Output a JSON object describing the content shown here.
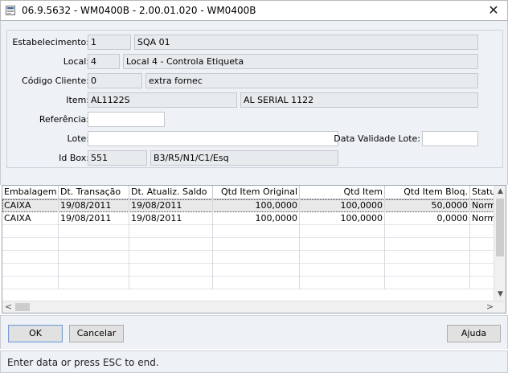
{
  "window": {
    "title": "06.9.5632 - WM0400B - 2.00.01.020 - WM0400B",
    "close_glyph": "✕"
  },
  "form": {
    "estabelecimento": {
      "label": "Estabelecimento:",
      "code": "1",
      "desc": "SQA 01"
    },
    "local": {
      "label": "Local:",
      "code": "4",
      "desc": "Local 4 - Controla Etiqueta"
    },
    "codigo_cliente": {
      "label": "Código Cliente:",
      "code": "0",
      "desc": "extra fornec"
    },
    "item": {
      "label": "Item:",
      "code": "AL1122S",
      "desc": "AL SERIAL 1122"
    },
    "referencia": {
      "label": "Referência:",
      "value": ""
    },
    "lote": {
      "label": "Lote:",
      "value": ""
    },
    "data_validade_lote": {
      "label": "Data Validade Lote:",
      "value": ""
    },
    "id_box": {
      "label": "Id Box:",
      "code": "551",
      "desc": "B3/R5/N1/C1/Esq"
    }
  },
  "grid": {
    "columns": [
      "Embalagem",
      "Dt. Transação",
      "Dt. Atualiz. Saldo",
      "Qtd Item Original",
      "Qtd Item",
      "Qtd Item Bloq.",
      "Status"
    ],
    "rows": [
      {
        "embalagem": "CAIXA",
        "dt_transacao": "19/08/2011",
        "dt_atualiz": "19/08/2011",
        "qtd_original": "100,0000",
        "qtd_item": "100,0000",
        "qtd_bloq": "50,0000",
        "status": "Normal"
      },
      {
        "embalagem": "CAIXA",
        "dt_transacao": "19/08/2011",
        "dt_atualiz": "19/08/2011",
        "qtd_original": "100,0000",
        "qtd_item": "100,0000",
        "qtd_bloq": "0,0000",
        "status": "Normal"
      }
    ],
    "scroll": {
      "up": "▲",
      "down": "▼",
      "left": "<",
      "right": ">"
    }
  },
  "buttons": {
    "ok": "OK",
    "cancelar": "Cancelar",
    "ajuda": "Ajuda"
  },
  "status": {
    "text": "Enter data or press ESC to end."
  },
  "colors": {
    "panel_bg": "#eef1f5",
    "field_bg": "#e8ebee",
    "selected_row": "#e9e9e9"
  }
}
